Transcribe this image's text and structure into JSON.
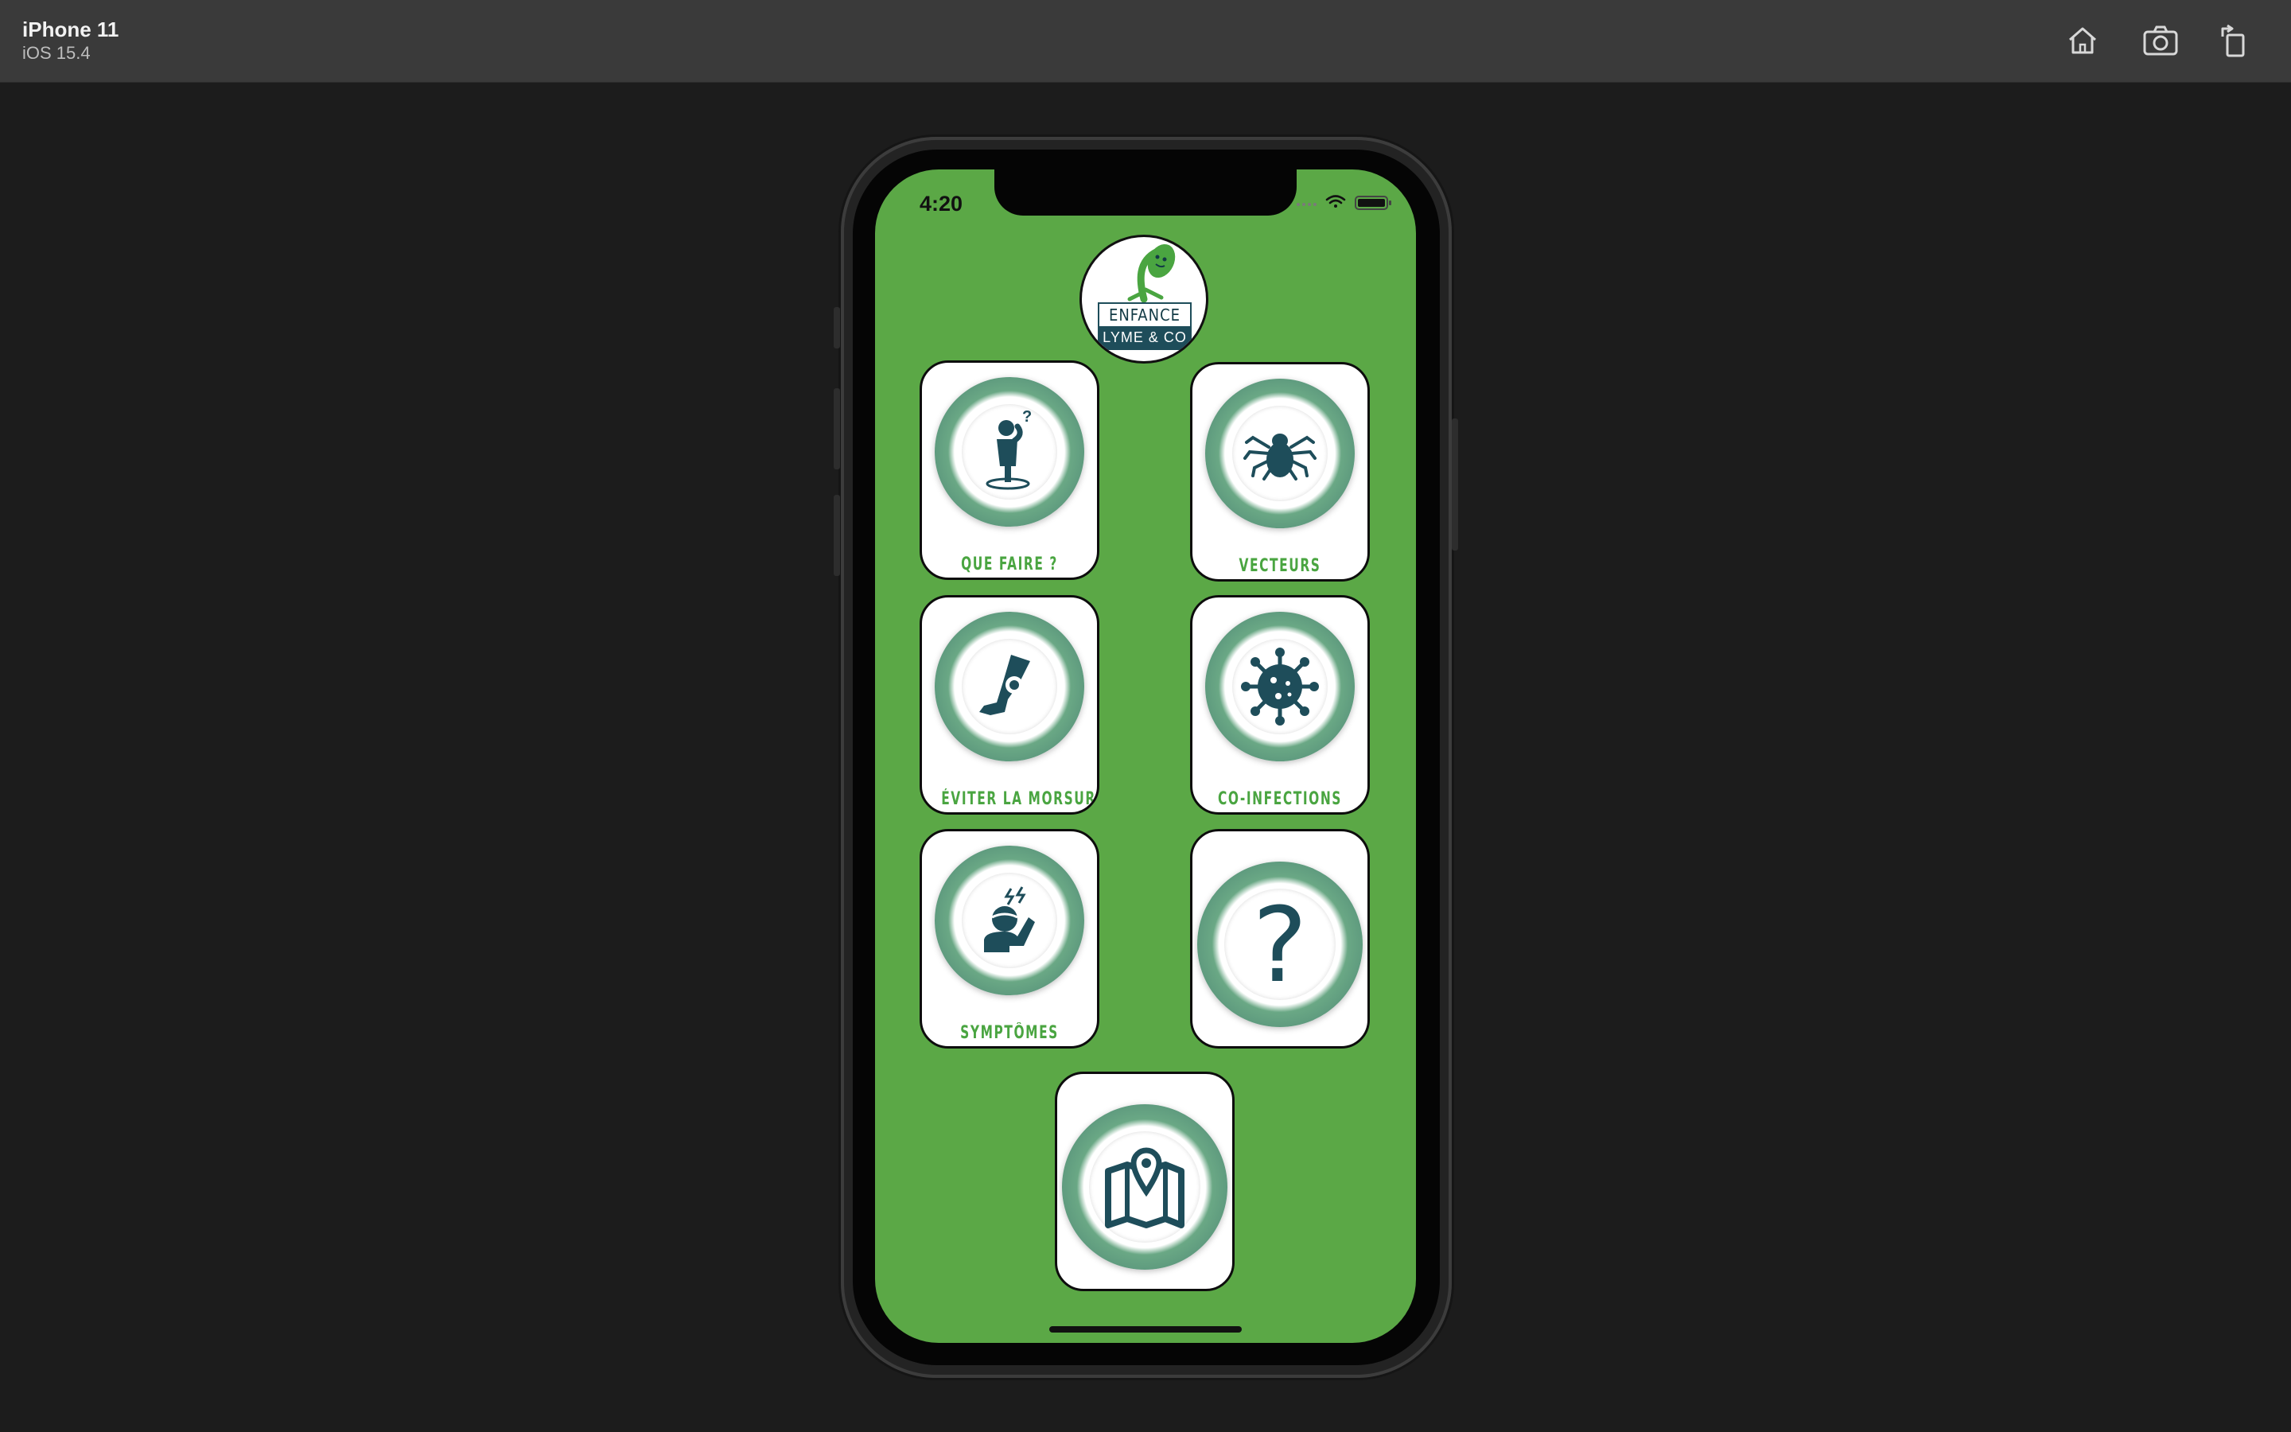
{
  "simulator": {
    "device_name": "iPhone 11",
    "os_version": "iOS 15.4",
    "toolbar_icons": [
      "home-icon",
      "screenshot-icon",
      "rotate-icon"
    ]
  },
  "status_bar": {
    "time": "4:20",
    "icons": [
      "signal-icon",
      "wifi-icon",
      "battery-icon"
    ]
  },
  "logo": {
    "line1": "ENFANCE",
    "line2": "LYME & CO"
  },
  "menu": [
    {
      "label": "QUE FAIRE ?",
      "icon": "confused-person-icon"
    },
    {
      "label": "VECTEURS",
      "icon": "tick-icon"
    },
    {
      "label": "ÉVITER LA MORSURE",
      "icon": "leg-tick-icon"
    },
    {
      "label": "CO-INFECTIONS",
      "icon": "virus-icon"
    },
    {
      "label": "SYMPTÔMES",
      "icon": "headache-icon"
    },
    {
      "label": "",
      "icon": "question-mark-icon"
    },
    {
      "label": "",
      "icon": "map-pin-icon"
    }
  ],
  "colors": {
    "screen_background": "#5ba846",
    "label_green": "#4aa541",
    "icon_teal": "#1e4d5a"
  }
}
